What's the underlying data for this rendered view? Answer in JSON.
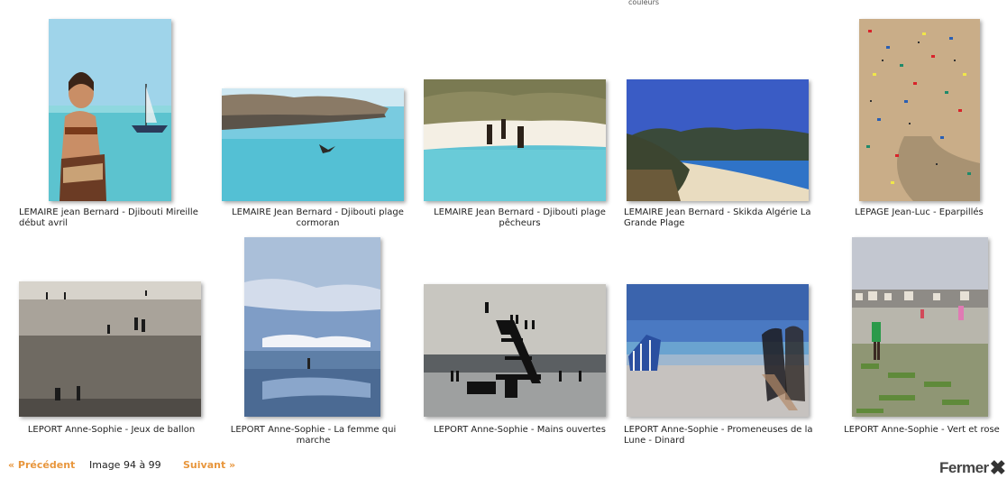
{
  "top_fragment": "couleurs",
  "photos": [
    {
      "caption": "LEMAIRE jean Bernard - Djibouti Mireille début avril",
      "subject": "woman-boat-sea"
    },
    {
      "caption": "LEMAIRE Jean Bernard - Djibouti plage cormoran",
      "subject": "rock-sea-bird"
    },
    {
      "caption": "LEMAIRE Jean Bernard - Djibouti plage pêcheurs",
      "subject": "beach-fishermen"
    },
    {
      "caption": "LEMAIRE Jean Bernard - Skikda Algérie La Grande Plage",
      "subject": "mountains-beach"
    },
    {
      "caption": "LEPAGE Jean-Luc - Eparpillés",
      "subject": "crowded-beach-aerial"
    },
    {
      "caption": "LEPORT Anne-Sophie - Jeux de ballon",
      "subject": "beach-ball-games"
    },
    {
      "caption": "LEPORT Anne-Sophie - La femme qui marche",
      "subject": "sky-reflection"
    },
    {
      "caption": "LEPORT Anne-Sophie - Mains ouvertes",
      "subject": "diving-platform"
    },
    {
      "caption": "LEPORT Anne-Sophie - Promeneuses de la Lune - Dinard",
      "subject": "blurred-walkers"
    },
    {
      "caption": "LEPORT Anne-Sophie - Vert et rose",
      "subject": "green-seaweed-beach"
    }
  ],
  "pager": {
    "prev_label": "« Précédent",
    "count_label": "Image 94 à 99",
    "next_label": "Suivant »"
  },
  "close": {
    "label": "Fermer",
    "icon": "close-x-icon"
  }
}
